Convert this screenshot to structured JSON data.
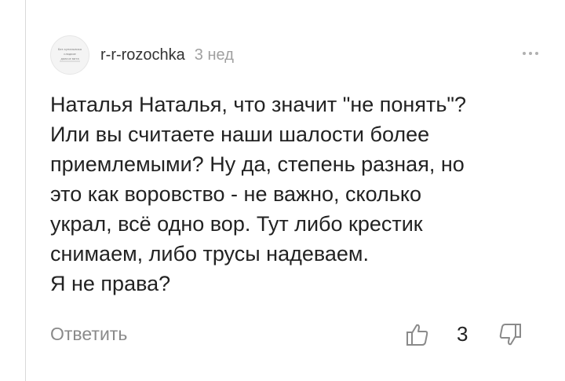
{
  "comment": {
    "author": "r-r-rozochka",
    "time_ago": "3 нед",
    "avatar_text": [
      "Без купальника",
      "сладкое",
      "дольче вита"
    ],
    "text_lines": [
      "Наталья Наталья, что значит \"не понять\"?",
      "Или вы считаете наши шалости более",
      "приемлемыми? Ну да, степень разная, но",
      "это как воровство - не важно, сколько",
      "украл, всё одно вор. Тут либо крестик",
      "снимаем, либо трусы надеваем.",
      "Я не права?"
    ],
    "reply_label": "Ответить",
    "like_count": "3"
  },
  "icons": {
    "menu": "more-dots-icon",
    "like": "thumb-up-icon",
    "dislike": "thumb-down-icon"
  },
  "colors": {
    "text": "#222222",
    "muted": "#a0a0a0",
    "reply": "#8a8a8a"
  }
}
